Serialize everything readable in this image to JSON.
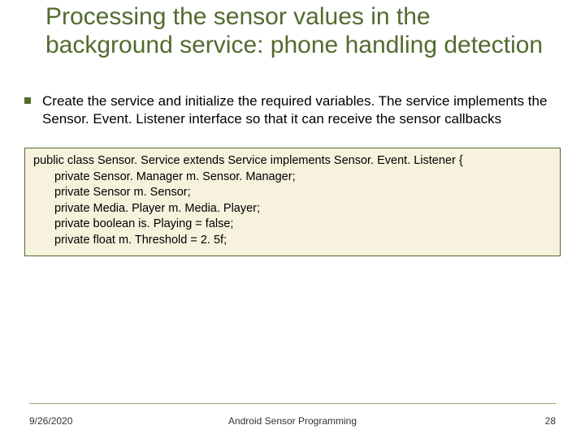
{
  "title": "Processing the sensor values in the background service: phone handling detection",
  "bullet": "Create the service and initialize the required variables. The service implements the Sensor. Event. Listener interface so that it can receive the sensor callbacks",
  "code": {
    "l1": "public class Sensor. Service extends Service implements Sensor. Event. Listener {",
    "l2": "private Sensor. Manager m. Sensor. Manager;",
    "l3": "private Sensor m. Sensor;",
    "l4": "private Media. Player m. Media. Player;",
    "l5": "private boolean is. Playing = false;",
    "l6": "private float m. Threshold = 2. 5f;"
  },
  "footer": {
    "date": "9/26/2020",
    "center": "Android Sensor Programming",
    "page": "28"
  }
}
